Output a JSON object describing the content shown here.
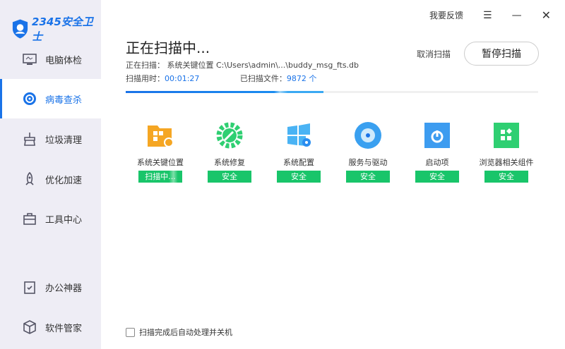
{
  "app": {
    "logo_text": "2345安全卫士"
  },
  "sidebar": {
    "items": [
      {
        "label": "电脑体检"
      },
      {
        "label": "病毒查杀"
      },
      {
        "label": "垃圾清理"
      },
      {
        "label": "优化加速"
      },
      {
        "label": "工具中心"
      },
      {
        "label": "办公神器"
      },
      {
        "label": "软件管家"
      }
    ]
  },
  "topbar": {
    "feedback": "我要反馈"
  },
  "scan": {
    "title": "正在扫描中...",
    "current_label": "正在扫描：",
    "current_value": "系统关键位置 C:\\Users\\admin\\...\\buddy_msg_fts.db",
    "time_label": "扫描用时：",
    "time_value": "00:01:27",
    "files_label": "已扫描文件：",
    "files_value": "9872 个",
    "progress": 0.48,
    "cancel": "取消扫描",
    "pause": "暂停扫描"
  },
  "items": [
    {
      "name": "系统关键位置",
      "status": "扫描中..."
    },
    {
      "name": "系统修复",
      "status": "安全"
    },
    {
      "name": "系统配置",
      "status": "安全"
    },
    {
      "name": "服务与驱动",
      "status": "安全"
    },
    {
      "name": "启动项",
      "status": "安全"
    },
    {
      "name": "浏览器相关组件",
      "status": "安全"
    }
  ],
  "footer": {
    "auto_shutdown": "扫描完成后自动处理并关机"
  }
}
